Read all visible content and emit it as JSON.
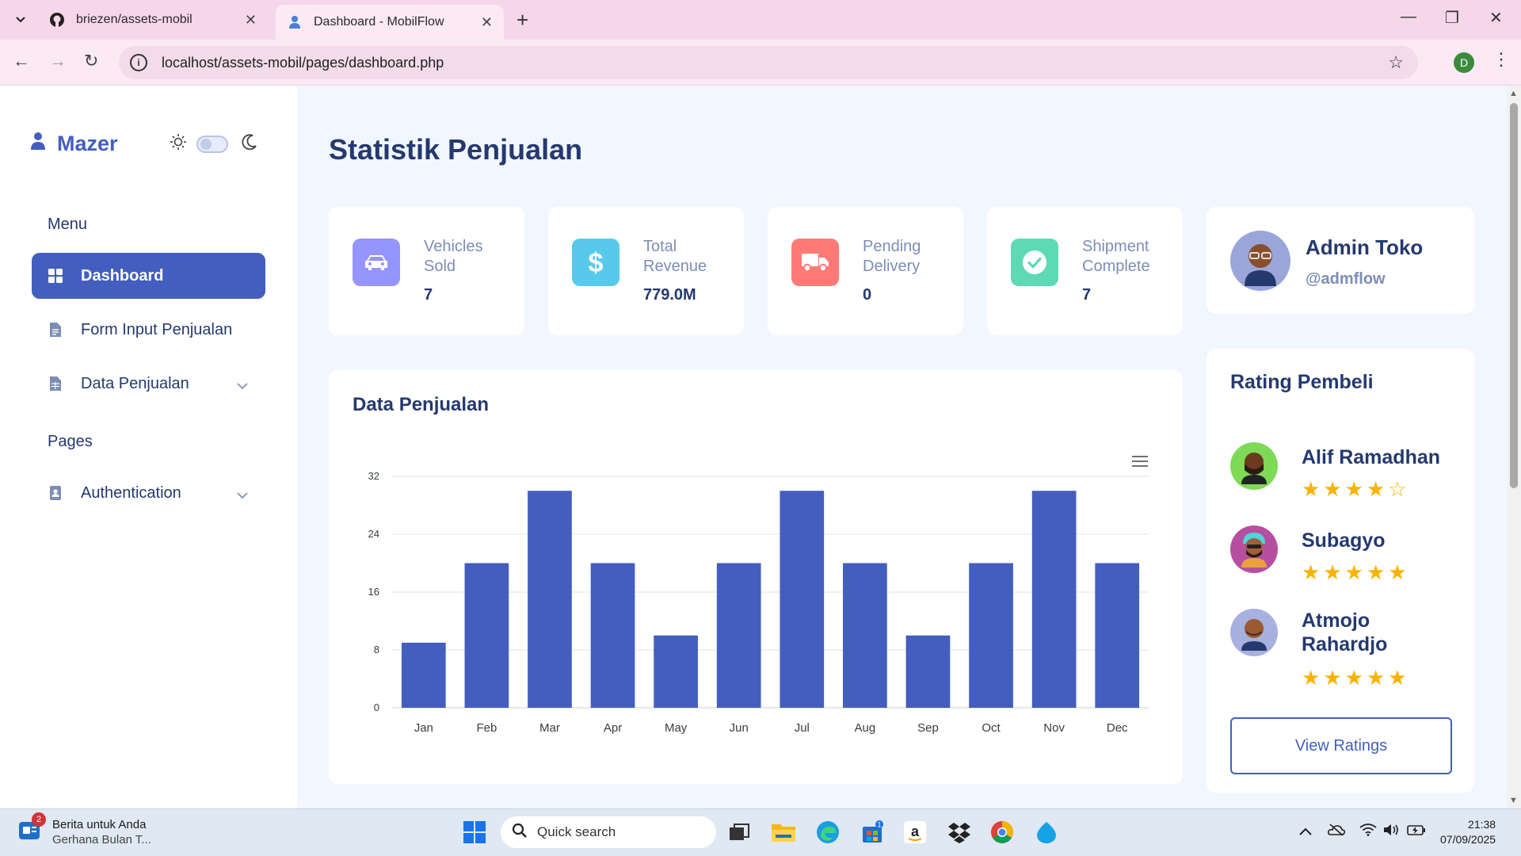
{
  "browser": {
    "tabs": [
      {
        "title": "briezen/assets-mobil",
        "icon": "github-icon"
      },
      {
        "title": "Dashboard - MobilFlow",
        "icon": "user-icon"
      }
    ],
    "url": "localhost/assets-mobil/pages/dashboard.php",
    "profile_initial": "D"
  },
  "sidebar": {
    "brand": "Mazer",
    "menu_heading": "Menu",
    "items": [
      {
        "label": "Dashboard",
        "icon": "grid-icon"
      },
      {
        "label": "Form Input Penjualan",
        "icon": "file-icon"
      },
      {
        "label": "Data Penjualan",
        "icon": "table-icon"
      }
    ],
    "pages_heading": "Pages",
    "pages_items": [
      {
        "label": "Authentication",
        "icon": "contact-icon"
      }
    ]
  },
  "main": {
    "title": "Statistik Penjualan",
    "stats": [
      {
        "label": "Vehicles Sold",
        "value": "7",
        "color": "#9694ff",
        "icon": "car-icon"
      },
      {
        "label": "Total Revenue",
        "value": "779.0M",
        "color": "#57caeb",
        "icon": "dollar-icon"
      },
      {
        "label": "Pending Delivery",
        "value": "0",
        "color": "#ff7976",
        "icon": "truck-icon"
      },
      {
        "label": "Shipment Complete",
        "value": "7",
        "color": "#5ddab4",
        "icon": "check-icon"
      }
    ],
    "chart_card_title": "Data Penjualan"
  },
  "chart_data": {
    "type": "bar",
    "categories": [
      "Jan",
      "Feb",
      "Mar",
      "Apr",
      "May",
      "Jun",
      "Jul",
      "Aug",
      "Sep",
      "Oct",
      "Nov",
      "Dec"
    ],
    "values": [
      9,
      20,
      30,
      20,
      10,
      20,
      30,
      20,
      10,
      20,
      30,
      20
    ],
    "yticks": [
      "0",
      "8",
      "16",
      "24",
      "32"
    ],
    "ylim": [
      0,
      32
    ],
    "color": "#435ebe",
    "grid": true
  },
  "profile": {
    "name": "Admin Toko",
    "handle": "@admflow"
  },
  "ratings": {
    "title": "Rating Pembeli",
    "people": [
      {
        "name": "Alif Ramadhan",
        "stars": 4,
        "avatar_color": "#7ed957"
      },
      {
        "name": "Subagyo",
        "stars": 5,
        "avatar_color": "#b64fa0"
      },
      {
        "name": "Atmojo Rahardjo",
        "stars": 5,
        "avatar_color": "#a7b0de"
      }
    ],
    "button": "View Ratings"
  },
  "taskbar": {
    "news_title": "Berita untuk Anda",
    "news_sub": "Gerhana Bulan T...",
    "news_badge": "2",
    "search_placeholder": "Quick search",
    "store_badge": "1",
    "time": "21:38",
    "date": "07/09/2025"
  }
}
